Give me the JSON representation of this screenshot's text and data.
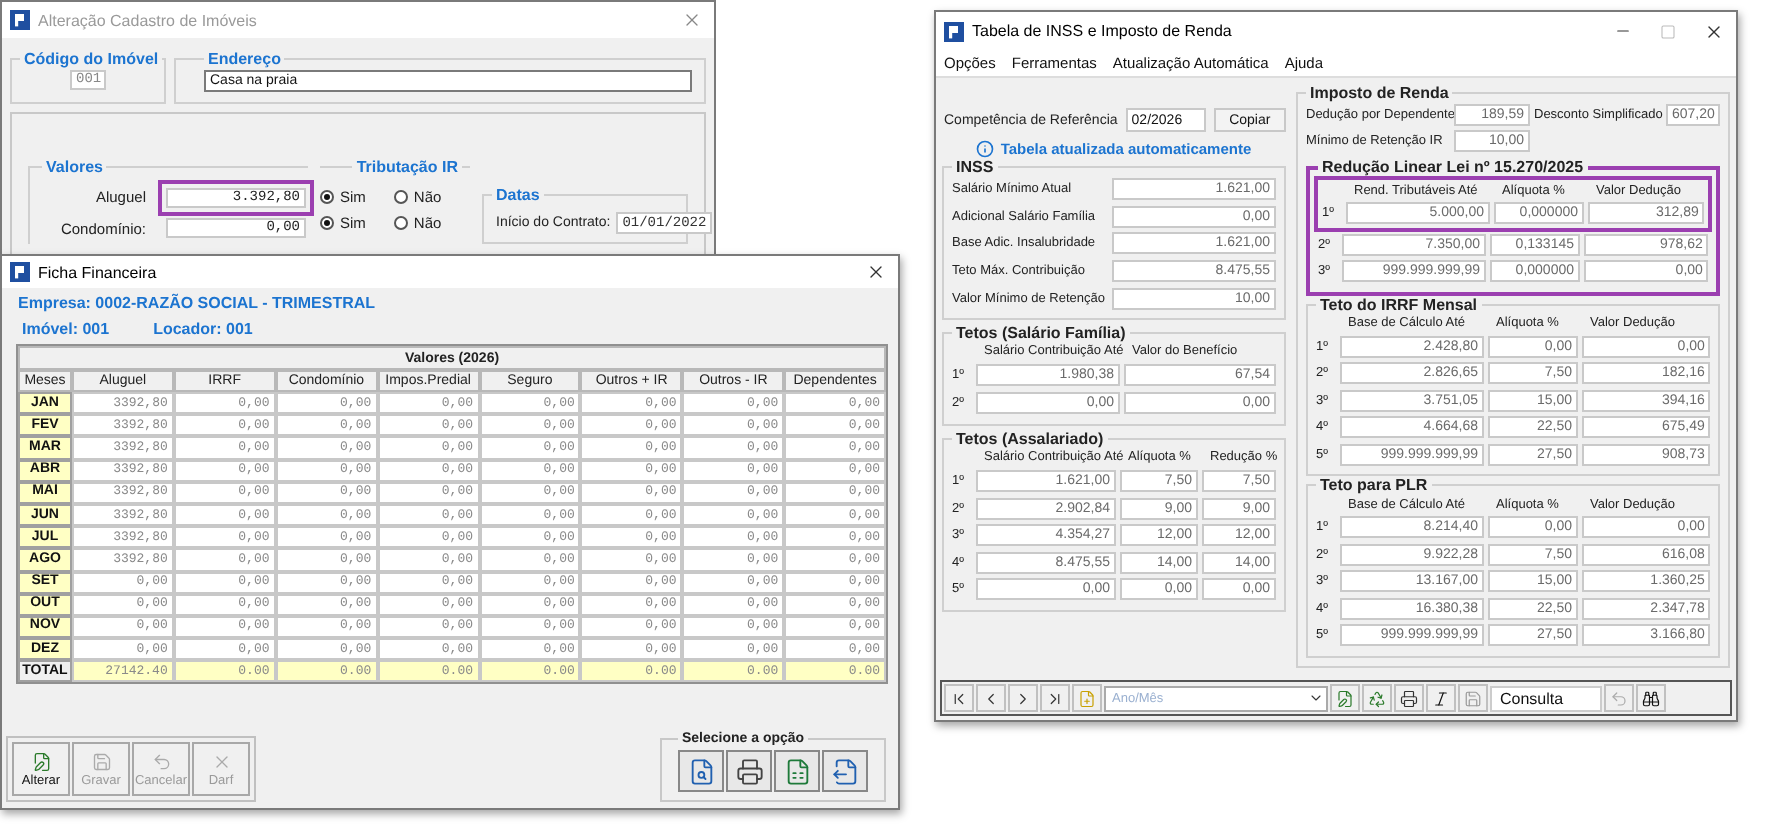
{
  "property_window": {
    "title": "Alteração Cadastro de Imóveis",
    "code_label": "Código do Imóvel",
    "code": "001",
    "address_label": "Endereço",
    "address": "Casa na praia",
    "values_label": "Valores",
    "value_fields": [
      {
        "label": "Aluguel",
        "value": "3.392,80",
        "highlighted": true
      },
      {
        "label": "Condomínio:",
        "value": "0,00",
        "highlighted": false
      }
    ],
    "tax_label": "Tributação IR",
    "tax_rows": [
      {
        "options": [
          {
            "label": "Sim",
            "selected": true
          },
          {
            "label": "Não",
            "selected": false
          }
        ]
      },
      {
        "options": [
          {
            "label": "Sim",
            "selected": true
          },
          {
            "label": "Não",
            "selected": false
          }
        ]
      }
    ],
    "dates_label": "Datas",
    "start_label": "Início do Contrato:",
    "start": "01/01/2022"
  },
  "ledger_window": {
    "title": "Ficha Financeira",
    "company": "Empresa: 0002-RAZÃO SOCIAL - TRIMESTRAL",
    "property": "Imóvel: 001",
    "landlord": "Locador: 001",
    "table": {
      "title": "Valores (2026)",
      "columns": [
        "Meses",
        "Aluguel",
        "IRRF",
        "Condomínio",
        "Impos.Predial",
        "Seguro",
        "Outros + IR",
        "Outros - IR",
        "Dependentes"
      ],
      "rows": [
        {
          "cells": [
            "JAN",
            "3392,80",
            "0,00",
            "0,00",
            "0,00",
            "0,00",
            "0,00",
            "0,00",
            "0,00"
          ]
        },
        {
          "cells": [
            "FEV",
            "3392,80",
            "0,00",
            "0,00",
            "0,00",
            "0,00",
            "0,00",
            "0,00",
            "0,00"
          ]
        },
        {
          "cells": [
            "MAR",
            "3392,80",
            "0,00",
            "0,00",
            "0,00",
            "0,00",
            "0,00",
            "0,00",
            "0,00"
          ]
        },
        {
          "cells": [
            "ABR",
            "3392,80",
            "0,00",
            "0,00",
            "0,00",
            "0,00",
            "0,00",
            "0,00",
            "0,00"
          ]
        },
        {
          "cells": [
            "MAI",
            "3392,80",
            "0,00",
            "0,00",
            "0,00",
            "0,00",
            "0,00",
            "0,00",
            "0,00"
          ]
        },
        {
          "cells": [
            "JUN",
            "3392,80",
            "0,00",
            "0,00",
            "0,00",
            "0,00",
            "0,00",
            "0,00",
            "0,00"
          ]
        },
        {
          "cells": [
            "JUL",
            "3392,80",
            "0,00",
            "0,00",
            "0,00",
            "0,00",
            "0,00",
            "0,00",
            "0,00"
          ]
        },
        {
          "cells": [
            "AGO",
            "3392,80",
            "0,00",
            "0,00",
            "0,00",
            "0,00",
            "0,00",
            "0,00",
            "0,00"
          ]
        },
        {
          "cells": [
            "SET",
            "0,00",
            "0,00",
            "0,00",
            "0,00",
            "0,00",
            "0,00",
            "0,00",
            "0,00"
          ]
        },
        {
          "cells": [
            "OUT",
            "0,00",
            "0,00",
            "0,00",
            "0,00",
            "0,00",
            "0,00",
            "0,00",
            "0,00"
          ]
        },
        {
          "cells": [
            "NOV",
            "0,00",
            "0,00",
            "0,00",
            "0,00",
            "0,00",
            "0,00",
            "0,00",
            "0,00"
          ]
        },
        {
          "cells": [
            "DEZ",
            "0,00",
            "0,00",
            "0,00",
            "0,00",
            "0,00",
            "0,00",
            "0,00",
            "0,00"
          ]
        }
      ],
      "total": {
        "cells": [
          "TOTAL",
          "27142.40",
          "0.00",
          "0.00",
          "0.00",
          "0.00",
          "0.00",
          "0.00",
          "0.00"
        ]
      }
    },
    "buttons": [
      {
        "kind": "edit",
        "label": "Alterar",
        "disabled": false
      },
      {
        "kind": "save",
        "label": "Gravar",
        "disabled": true
      },
      {
        "kind": "undo",
        "label": "Cancelar",
        "disabled": true
      },
      {
        "kind": "close",
        "label": "Darf",
        "disabled": true
      }
    ],
    "options_label": "Selecione a opção",
    "options": [
      {
        "kind": "preview"
      },
      {
        "kind": "print"
      },
      {
        "kind": "excel"
      },
      {
        "kind": "export"
      }
    ]
  },
  "tax_window": {
    "title": "Tabela de INSS e Imposto de Renda",
    "menu": [
      "Opções",
      "Ferramentas",
      "Atualização Automática",
      "Ajuda"
    ],
    "reference_label": "Competência de Referência",
    "reference": "02/2026",
    "copy_button": "Copiar",
    "notice": "Tabela atualizada automaticamente",
    "inss": {
      "title": "INSS",
      "fields": [
        {
          "label": "Salário Mínimo Atual",
          "value": "1.621,00"
        },
        {
          "label": "Adicional Salário Família",
          "value": "0,00"
        },
        {
          "label": "Base Adic. Insalubridade",
          "value": "1.621,00"
        },
        {
          "label": "Teto Máx. Contribuição",
          "value": "8.475,55"
        },
        {
          "label": "Valor Mínimo de Retenção",
          "value": "10,00"
        }
      ]
    },
    "family": {
      "title": "Tetos (Salário Família)",
      "columns": [
        "Salário Contribuição Até",
        "Valor do Benefício"
      ],
      "rows": [
        {
          "ordinal": "1º",
          "values": [
            "1.980,38",
            "67,54"
          ]
        },
        {
          "ordinal": "2º",
          "values": [
            "0,00",
            "0,00"
          ]
        }
      ]
    },
    "salaried": {
      "title": "Tetos (Assalariado)",
      "columns": [
        "Salário Contribuição Até",
        "Alíquota %",
        "Redução %"
      ],
      "rows": [
        {
          "ordinal": "1º",
          "values": [
            "1.621,00",
            "7,50",
            "7,50"
          ]
        },
        {
          "ordinal": "2º",
          "values": [
            "2.902,84",
            "9,00",
            "9,00"
          ]
        },
        {
          "ordinal": "3º",
          "values": [
            "4.354,27",
            "12,00",
            "12,00"
          ]
        },
        {
          "ordinal": "4º",
          "values": [
            "8.475,55",
            "14,00",
            "14,00"
          ]
        },
        {
          "ordinal": "5º",
          "values": [
            "0,00",
            "0,00",
            "0,00"
          ]
        }
      ]
    },
    "income_tax": {
      "title": "Imposto de Renda",
      "fields": [
        {
          "label": "Dedução por Dependente",
          "value": "189,59"
        },
        {
          "label": "Desconto Simplificado",
          "value": "607,20"
        },
        {
          "label": "Mínimo de Retenção IR",
          "value": "10,00"
        }
      ]
    },
    "reduction": {
      "title": "Redução Linear Lei nº 15.270/2025",
      "highlighted": true,
      "columns": [
        "Rend. Tributáveis Até",
        "Alíquota %",
        "Valor Dedução"
      ],
      "rows": [
        {
          "ordinal": "1º",
          "values": [
            "5.000,00",
            "0,000000",
            "312,89"
          ],
          "highlighted": true
        },
        {
          "ordinal": "2º",
          "values": [
            "7.350,00",
            "0,133145",
            "978,62"
          ],
          "highlighted": false
        },
        {
          "ordinal": "3º",
          "values": [
            "999.999.999,99",
            "0,000000",
            "0,00"
          ],
          "highlighted": false
        }
      ]
    },
    "irrf": {
      "title": "Teto do IRRF Mensal",
      "columns": [
        "Base de Cálculo Até",
        "Alíquota %",
        "Valor Dedução"
      ],
      "rows": [
        {
          "ordinal": "1º",
          "values": [
            "2.428,80",
            "0,00",
            "0,00"
          ]
        },
        {
          "ordinal": "2º",
          "values": [
            "2.826,65",
            "7,50",
            "182,16"
          ]
        },
        {
          "ordinal": "3º",
          "values": [
            "3.751,05",
            "15,00",
            "394,16"
          ]
        },
        {
          "ordinal": "4º",
          "values": [
            "4.664,68",
            "22,50",
            "675,49"
          ]
        },
        {
          "ordinal": "5º",
          "values": [
            "999.999.999,99",
            "27,50",
            "908,73"
          ]
        }
      ]
    },
    "plr": {
      "title": "Teto para PLR",
      "columns": [
        "Base de Cálculo Até",
        "Alíquota %",
        "Valor Dedução"
      ],
      "rows": [
        {
          "ordinal": "1º",
          "values": [
            "8.214,40",
            "0,00",
            "0,00"
          ]
        },
        {
          "ordinal": "2º",
          "values": [
            "9.922,28",
            "7,50",
            "616,08"
          ]
        },
        {
          "ordinal": "3º",
          "values": [
            "13.167,00",
            "15,00",
            "1.360,25"
          ]
        },
        {
          "ordinal": "4º",
          "values": [
            "16.380,38",
            "22,50",
            "2.347,78"
          ]
        },
        {
          "ordinal": "5º",
          "values": [
            "999.999.999,99",
            "27,50",
            "3.166,80"
          ]
        }
      ]
    },
    "toolbar": {
      "period_placeholder": "Ano/Mês",
      "mode": "Consulta"
    }
  }
}
